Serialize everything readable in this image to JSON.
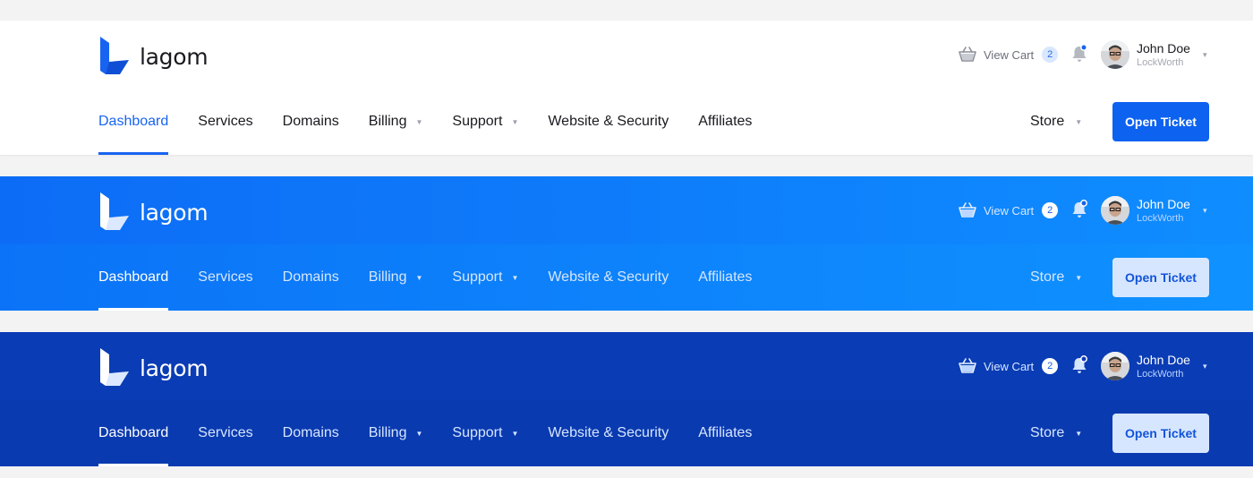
{
  "colors": {
    "light_background": "#ffffff",
    "blue_background": "#0f80fb",
    "dark_background": "#0a3cb5",
    "accent": "#1864f1",
    "cart_badge_light": "#d9e8ff"
  },
  "variants": [
    {
      "theme": "light",
      "logo": {
        "icon": "lagom-logo-icon",
        "text": "lagom"
      },
      "cart": {
        "icon": "basket-icon",
        "label": "View Cart",
        "count": "2"
      },
      "notifications": {
        "icon": "bell-icon",
        "has_unread": true
      },
      "user": {
        "name": "John Doe",
        "organization": "LockWorth",
        "caret": "▾"
      },
      "nav": [
        {
          "label": "Dashboard",
          "active": true,
          "has_dropdown": false
        },
        {
          "label": "Services",
          "active": false,
          "has_dropdown": false
        },
        {
          "label": "Domains",
          "active": false,
          "has_dropdown": false
        },
        {
          "label": "Billing",
          "active": false,
          "has_dropdown": true,
          "caret": "▼"
        },
        {
          "label": "Support",
          "active": false,
          "has_dropdown": true,
          "caret": "▼"
        },
        {
          "label": "Website & Security",
          "active": false,
          "has_dropdown": false
        },
        {
          "label": "Affiliates",
          "active": false,
          "has_dropdown": false
        }
      ],
      "store": {
        "label": "Store",
        "caret": "▼"
      },
      "cta": {
        "label": "Open Ticket"
      }
    },
    {
      "theme": "blue",
      "logo": {
        "icon": "lagom-logo-icon",
        "text": "lagom"
      },
      "cart": {
        "icon": "basket-icon",
        "label": "View Cart",
        "count": "2"
      },
      "notifications": {
        "icon": "bell-icon",
        "has_unread": true
      },
      "user": {
        "name": "John Doe",
        "organization": "LockWorth",
        "caret": "▾"
      },
      "nav": [
        {
          "label": "Dashboard",
          "active": true,
          "has_dropdown": false
        },
        {
          "label": "Services",
          "active": false,
          "has_dropdown": false
        },
        {
          "label": "Domains",
          "active": false,
          "has_dropdown": false
        },
        {
          "label": "Billing",
          "active": false,
          "has_dropdown": true,
          "caret": "▼"
        },
        {
          "label": "Support",
          "active": false,
          "has_dropdown": true,
          "caret": "▼"
        },
        {
          "label": "Website & Security",
          "active": false,
          "has_dropdown": false
        },
        {
          "label": "Affiliates",
          "active": false,
          "has_dropdown": false
        }
      ],
      "store": {
        "label": "Store",
        "caret": "▼"
      },
      "cta": {
        "label": "Open Ticket"
      }
    },
    {
      "theme": "dark",
      "logo": {
        "icon": "lagom-logo-icon",
        "text": "lagom"
      },
      "cart": {
        "icon": "basket-icon",
        "label": "View Cart",
        "count": "2"
      },
      "notifications": {
        "icon": "bell-icon",
        "has_unread": true
      },
      "user": {
        "name": "John Doe",
        "organization": "LockWorth",
        "caret": "▾"
      },
      "nav": [
        {
          "label": "Dashboard",
          "active": true,
          "has_dropdown": false
        },
        {
          "label": "Services",
          "active": false,
          "has_dropdown": false
        },
        {
          "label": "Domains",
          "active": false,
          "has_dropdown": false
        },
        {
          "label": "Billing",
          "active": false,
          "has_dropdown": true,
          "caret": "▼"
        },
        {
          "label": "Support",
          "active": false,
          "has_dropdown": true,
          "caret": "▼"
        },
        {
          "label": "Website & Security",
          "active": false,
          "has_dropdown": false
        },
        {
          "label": "Affiliates",
          "active": false,
          "has_dropdown": false
        }
      ],
      "store": {
        "label": "Store",
        "caret": "▼"
      },
      "cta": {
        "label": "Open Ticket"
      }
    }
  ]
}
